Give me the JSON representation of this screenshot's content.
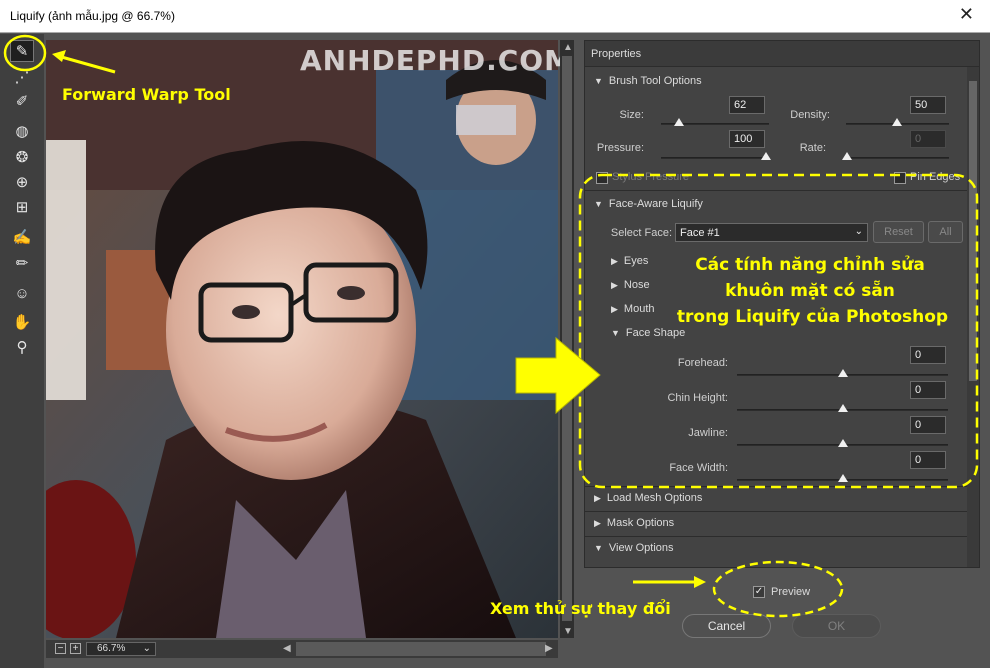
{
  "window": {
    "title": "Liquify (ảnh mẫu.jpg @ 66.7%)",
    "close_glyph": "✕"
  },
  "tools": [
    {
      "name": "forward-warp-tool",
      "glyph": "✎",
      "active": true
    },
    {
      "name": "reconstruct-tool",
      "glyph": "⋰"
    },
    {
      "name": "smooth-tool",
      "glyph": "✐"
    },
    {
      "name": "twirl-clockwise-tool",
      "glyph": "◍"
    },
    {
      "name": "pucker-tool",
      "glyph": "❂"
    },
    {
      "name": "bloat-tool",
      "glyph": "⊕"
    },
    {
      "name": "push-left-tool",
      "glyph": "⊞"
    },
    {
      "name": "freeze-mask-tool",
      "glyph": "✍"
    },
    {
      "name": "thaw-mask-tool",
      "glyph": "✏"
    },
    {
      "name": "face-tool",
      "glyph": "☺"
    },
    {
      "name": "hand-tool",
      "glyph": "✋"
    },
    {
      "name": "zoom-tool",
      "glyph": "⚲"
    }
  ],
  "statusbar": {
    "minus": "−",
    "plus": "+",
    "zoom": "66.7%",
    "zoom_chev": "⌄"
  },
  "watermark": "ANHDEPHD.COM",
  "properties": {
    "title": "Properties",
    "brush": {
      "title": "Brush Tool Options",
      "size_label": "Size:",
      "size": "62",
      "density_label": "Density:",
      "density": "50",
      "pressure_label": "Pressure:",
      "pressure": "100",
      "rate_label": "Rate:",
      "rate": "0",
      "stylus_label": "Stylus Pressure",
      "pin_edges_label": "Pin Edges"
    },
    "face": {
      "title": "Face-Aware Liquify",
      "select_face_label": "Select Face:",
      "select_face_value": "Face #1",
      "reset_label": "Reset",
      "all_label": "All",
      "eyes": "Eyes",
      "nose": "Nose",
      "mouth": "Mouth",
      "face_shape": "Face Shape",
      "sliders": [
        {
          "label": "Forehead:",
          "value": "0"
        },
        {
          "label": "Chin Height:",
          "value": "0"
        },
        {
          "label": "Jawline:",
          "value": "0"
        },
        {
          "label": "Face Width:",
          "value": "0"
        }
      ]
    },
    "load_mesh": "Load Mesh Options",
    "mask": "Mask Options",
    "view": "View Options"
  },
  "preview_label": "Preview",
  "cancel_label": "Cancel",
  "ok_label": "OK",
  "annotations": {
    "forward_warp": "Forward Warp Tool",
    "features_line1": "Các tính năng chỉnh sửa",
    "features_line2": "khuôn mặt có sẵn",
    "features_line3": "trong Liquify của Photoshop",
    "preview_note": "Xem thử sự thay đổi"
  },
  "colors": {
    "annotation": "#ffff00",
    "panel_bg": "#434343",
    "app_bg": "#535353"
  }
}
